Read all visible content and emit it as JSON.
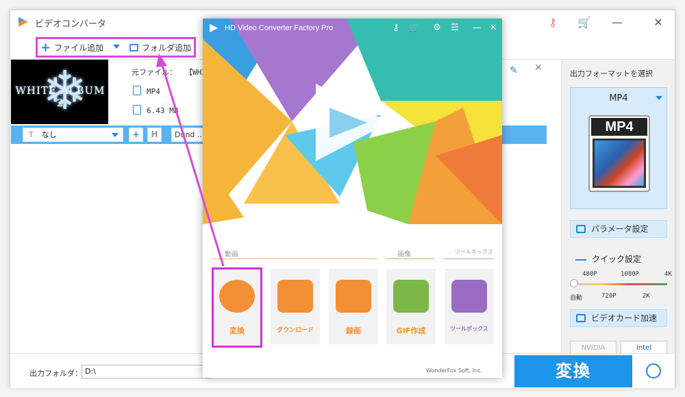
{
  "app": {
    "title": "ビデオコンバータ"
  },
  "toolbar": {
    "add_file": "ファイル追加",
    "add_folder": "フォルダ追加"
  },
  "file": {
    "thumb_title": "WHITE ALBUM 2",
    "source_label": "元ファイル：",
    "source_name": "【WHI",
    "format": "MP4",
    "size": "6.43 MB"
  },
  "options": {
    "subtitle": "なし",
    "subtitle_icon": "T",
    "audio": "Dund ..."
  },
  "right_panel": {
    "title": "出力フォーマットを選択",
    "format": "MP4",
    "format_img_label": "MP4",
    "param_button": "パラメータ設定",
    "quick_title": "クイック設定",
    "res_top": [
      "480P",
      "1080P",
      "4K"
    ],
    "res_bottom": [
      "自動",
      "720P",
      "2K"
    ],
    "gpu_button": "ビデオカード加速",
    "hw": [
      "NVIDIA",
      "Intel"
    ]
  },
  "bottom": {
    "output_label": "出力フォルダ：",
    "output_value": "D:\\",
    "convert": "変換"
  },
  "popup": {
    "title": "HD Video Converter Factory Pro",
    "sections": {
      "video": "動画",
      "image": "画像",
      "toolbox": "ツールボックス"
    },
    "tiles": [
      {
        "label": "変換",
        "color": "#f39036"
      },
      {
        "label": "ダウンロード",
        "color": "#f39036"
      },
      {
        "label": "録画",
        "color": "#f39036"
      },
      {
        "label": "GIF作成",
        "color": "#7ab648"
      },
      {
        "label": "ツールボックス",
        "color": "#9b6cc4"
      }
    ],
    "footer": "WonderFox Soft, Inc."
  }
}
